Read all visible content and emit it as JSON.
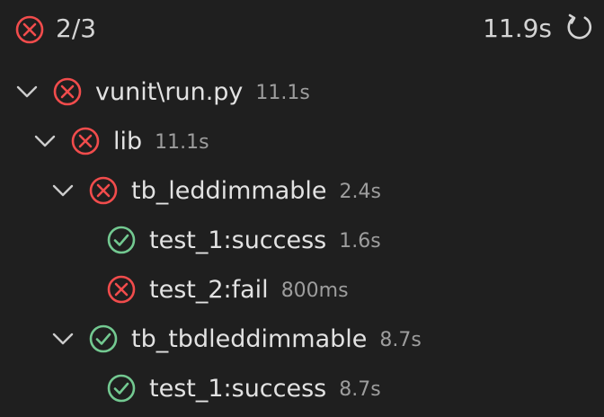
{
  "header": {
    "status_icon": "error-circle-icon",
    "count": "2/3",
    "total_time": "11.9s",
    "refresh_icon": "refresh-icon"
  },
  "colors": {
    "fail": "#f14c4c",
    "pass": "#73c991",
    "text": "#e2e2e2",
    "muted": "#9d9d9d",
    "background": "#1f1f1f"
  },
  "tree": [
    {
      "name": "vunit\\run.py",
      "duration": "11.1s",
      "status": "fail",
      "expanded": true,
      "level": 0
    },
    {
      "name": "lib",
      "duration": "11.1s",
      "status": "fail",
      "expanded": true,
      "level": 1
    },
    {
      "name": "tb_leddimmable",
      "duration": "2.4s",
      "status": "fail",
      "expanded": true,
      "level": 2
    },
    {
      "name": "test_1:success",
      "duration": "1.6s",
      "status": "pass",
      "expanded": null,
      "level": 3
    },
    {
      "name": "test_2:fail",
      "duration": "800ms",
      "status": "fail",
      "expanded": null,
      "level": 3
    },
    {
      "name": "tb_tbdleddimmable",
      "duration": "8.7s",
      "status": "pass",
      "expanded": true,
      "level": 2
    },
    {
      "name": "test_1:success",
      "duration": "8.7s",
      "status": "pass",
      "expanded": null,
      "level": 3
    }
  ]
}
